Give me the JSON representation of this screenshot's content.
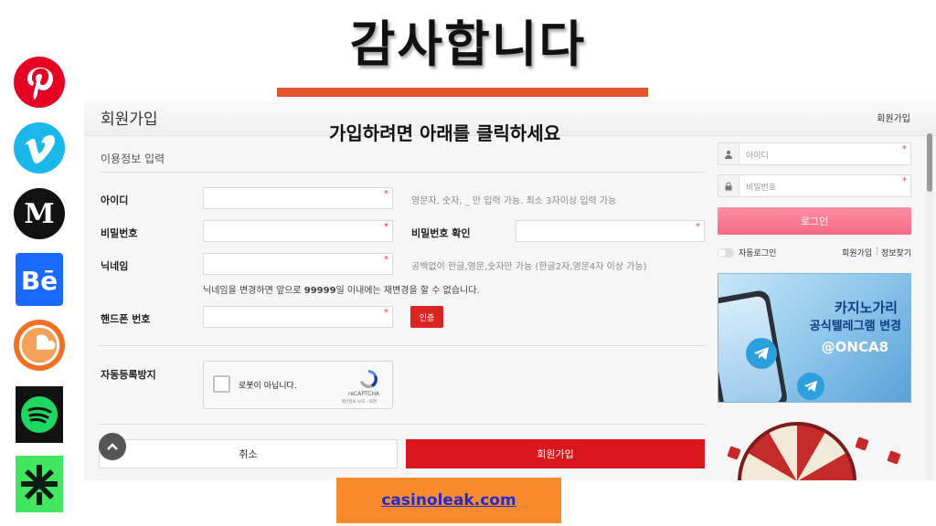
{
  "title": "감사합니다",
  "colors": {
    "title_bar": "#e5542f",
    "accent_red": "#d9161b",
    "login_pink": "#f56a86",
    "bottom_box": "#f98a2d",
    "link_blue": "#1f2bd1"
  },
  "social_icons": [
    "pinterest-icon",
    "vimeo-icon",
    "medium-icon",
    "behance-icon",
    "soundcloud-icon",
    "spotify-icon",
    "linktree-icon"
  ],
  "panel": {
    "title": "회원가입",
    "header_link": "회원가입",
    "overlay": "가입하려면 아래를 클릭하세요",
    "section_title": "이용정보 입력",
    "fields": {
      "id_label": "아이디",
      "id_hint": "영문자, 숫자, _ 만 입력 가능. 최소 3자이상 입력 가능",
      "pw_label": "비밀번호",
      "pw_confirm_label": "비밀번호 확인",
      "nick_label": "닉네임",
      "nick_hint": "공백없이 한글,영문,숫자만 가능 (한글2자,영문4자 이상 가능)",
      "nick_note_pre": "닉네임을 변경하면 앞으로 ",
      "nick_note_days": "99999",
      "nick_note_post": "일 이내에는 재변경을 할 수 없습니다.",
      "phone_label": "핸드폰 번호",
      "verify_button": "인증",
      "captcha_label": "자동등록방지",
      "required_mark": "*"
    },
    "captcha": {
      "text": "로봇이 아닙니다.",
      "brand": "reCAPTCHA",
      "terms": "개인정보 보호 - 약관"
    },
    "buttons": {
      "cancel": "취소",
      "join": "회원가입"
    },
    "sidebar": {
      "id_placeholder": "아이디",
      "pw_placeholder": "비밀번호",
      "login": "로그인",
      "auto_login": "자동로그인",
      "signup": "회원가입",
      "separator": "|",
      "find_info": "정보찾기",
      "banner": {
        "line1": "카지노가리",
        "line2": "공식텔레그램 변경",
        "line3": "@ONCA8"
      }
    }
  },
  "bottom_link": "casinoleak.com"
}
